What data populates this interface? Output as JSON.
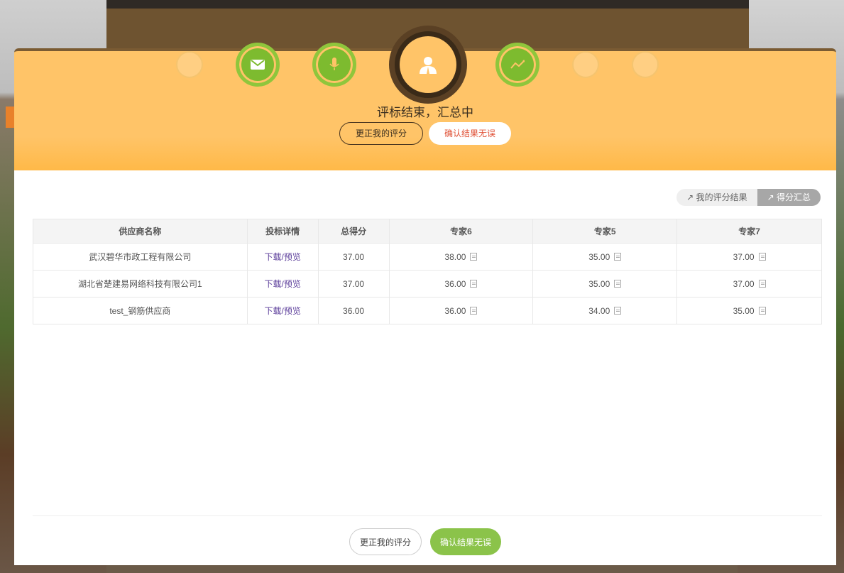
{
  "header": {
    "title": "评标结束，汇总中",
    "correct_button": "更正我的评分",
    "confirm_button": "确认结果无误"
  },
  "steps": [
    {
      "icon": "circle",
      "state": "inactive"
    },
    {
      "icon": "envelope-icon",
      "state": "done"
    },
    {
      "icon": "microphone-icon",
      "state": "done"
    },
    {
      "icon": "user-icon",
      "state": "active"
    },
    {
      "icon": "chart-line-icon",
      "state": "done"
    },
    {
      "icon": "circle",
      "state": "inactive"
    },
    {
      "icon": "circle",
      "state": "inactive"
    }
  ],
  "view_toggle": {
    "my_result": "我的评分结果",
    "summary": "得分汇总",
    "selected": "summary"
  },
  "table": {
    "headers": [
      "供应商名称",
      "投标详情",
      "总得分",
      "专家6",
      "专家5",
      "专家7"
    ],
    "rows": [
      {
        "supplier": "武汉碧华市政工程有限公司",
        "detail": "下载/预览",
        "total": "37.00",
        "e6": "38.00",
        "e5": "35.00",
        "e7": "37.00"
      },
      {
        "supplier": "湖北省楚建易网络科技有限公司1",
        "detail": "下载/预览",
        "total": "37.00",
        "e6": "36.00",
        "e5": "35.00",
        "e7": "37.00"
      },
      {
        "supplier": "test_钢筋供应商",
        "detail": "下载/预览",
        "total": "36.00",
        "e6": "36.00",
        "e5": "34.00",
        "e7": "35.00"
      }
    ]
  },
  "footer": {
    "correct_button": "更正我的评分",
    "confirm_button": "确认结果无误"
  },
  "colors": {
    "header_bg": "#ffc468",
    "accent_green": "#8bc34a",
    "supplier_text": "#8bb84a",
    "link_purple": "#5b3d9a",
    "confirm_red": "#e0543a"
  }
}
